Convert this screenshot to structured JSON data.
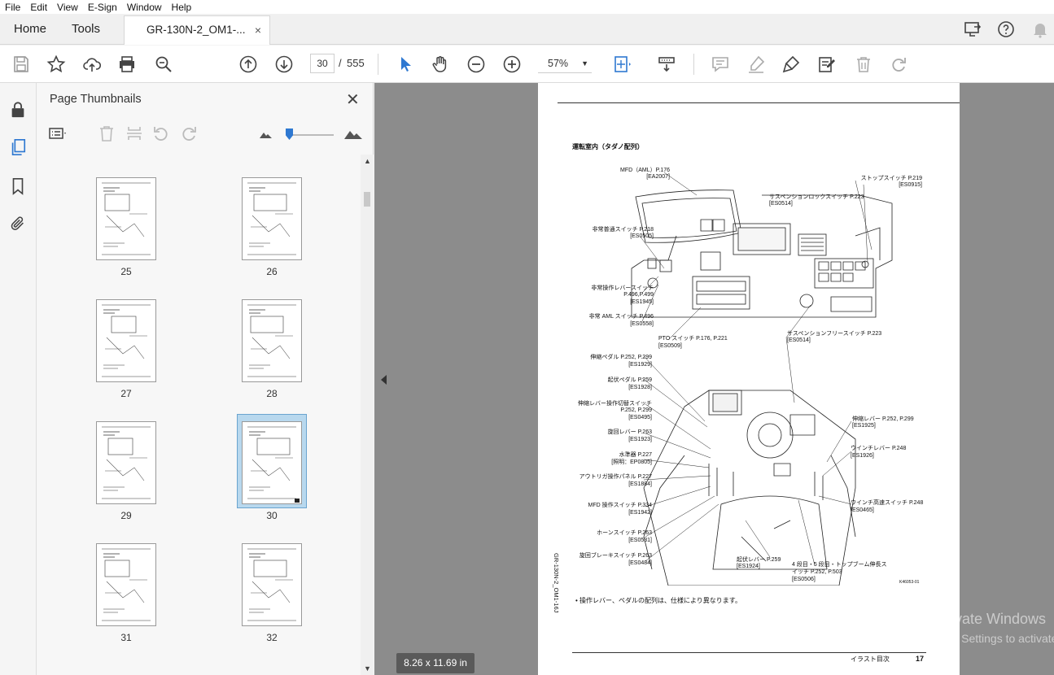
{
  "menu": [
    "File",
    "Edit",
    "View",
    "E-Sign",
    "Window",
    "Help"
  ],
  "tabs": {
    "home": "Home",
    "tools": "Tools",
    "document": "GR-130N-2_OM1-...",
    "close": "×"
  },
  "toolbar": {
    "current_page": "30",
    "separator": "/",
    "total_pages": "555",
    "zoom": "57%",
    "zoom_caret": "▼"
  },
  "thumbnails": {
    "title": "Page Thumbnails",
    "close": "✕",
    "pages": [
      "25",
      "26",
      "27",
      "28",
      "29",
      "30",
      "31",
      "32"
    ],
    "selected": "30"
  },
  "page_size": "8.26 x 11.69 in",
  "watermark": {
    "line1": "Activate Windows",
    "line2": "Go to Settings to activate"
  },
  "document_page": {
    "heading": "運転室内（タダノ配列）",
    "side_code": "GR-130N-2_OM1-16J",
    "labels": {
      "mfd": "MFD（AML）P.176",
      "mfd_code": "[EA2007]",
      "stop_switch": "ストップスイッチ P.219",
      "stop_code": "[ES0915]",
      "susp_lock": "サスペンションロックスイッチ P.223",
      "susp_lock_code": "[ES0514]",
      "emergency_bypass": "非常普通スイッチ P.218",
      "emergency_bypass_code": "[ES0505]",
      "emergency_lever": "非常操作レバースイッチ",
      "emergency_lever_pages": "P.496,P.499",
      "emergency_lever_code": "[ES1945]",
      "emergency_aml": "非常 AML スイッチ P.496",
      "emergency_aml_code": "[ES0558]",
      "pto": "PTO スイッチ P.176, P.221",
      "pto_code": "[ES0509]",
      "susp_free": "サスペンションフリースイッチ P.223",
      "susp_free_code": "[ES0514]",
      "tele_pedal": "伸縮ペダル P.252, P.299",
      "tele_pedal_code": "[ES1929]",
      "derrick_pedal": "起伏ペダル P.259",
      "derrick_pedal_code": "[ES1928]",
      "tele_select": "伸縮レバー操作切替スイッチ",
      "tele_select_pages": "P.252, P.299",
      "tele_select_code": "[ES0495]",
      "swing_lever": "旋回レバー P.263",
      "swing_lever_code": "[ES1923]",
      "level": "水準器 P.227",
      "level_code": "[照明：EP0805]",
      "outrigger": "アウトリガ操作パネル P.227",
      "outrigger_code": "[ES1884]",
      "mfd_switch": "MFD 操作スイッチ P.334",
      "mfd_switch_code": "[ES1942]",
      "horn": "ホーンスイッチ P.263",
      "horn_code": "[ES0531]",
      "swing_brake": "旋回ブレーキスイッチ P.263",
      "swing_brake_code": "[ES0484]",
      "tele_lever": "伸縮レバー P.252, P.299",
      "tele_lever_code": "[ES1925]",
      "winch_lever": "ウインチレバー P.248",
      "winch_lever_code": "[ES1926]",
      "winch_speed": "ウインチ高速スイッチ P.248",
      "winch_speed_code": "[ES0465]",
      "derrick_lever": "起伏レバー P.259",
      "derrick_lever_code": "[ES1924]",
      "boom_switch_1": "4 段目・5 段目・トップブーム伸長ス",
      "boom_switch_2": "イッチ P.252, P.503",
      "boom_switch_code": "[ES0506]",
      "figure_code": "K46053-01"
    },
    "note": "• 操作レバー、ペダルの配列は、仕様により異なります。",
    "footer_title": "イラスト目次",
    "footer_page": "17"
  },
  "colors": {
    "accent": "#2e78d1",
    "doc_bg": "#8c8c8c",
    "toolbar_bg": "#ffffff"
  }
}
